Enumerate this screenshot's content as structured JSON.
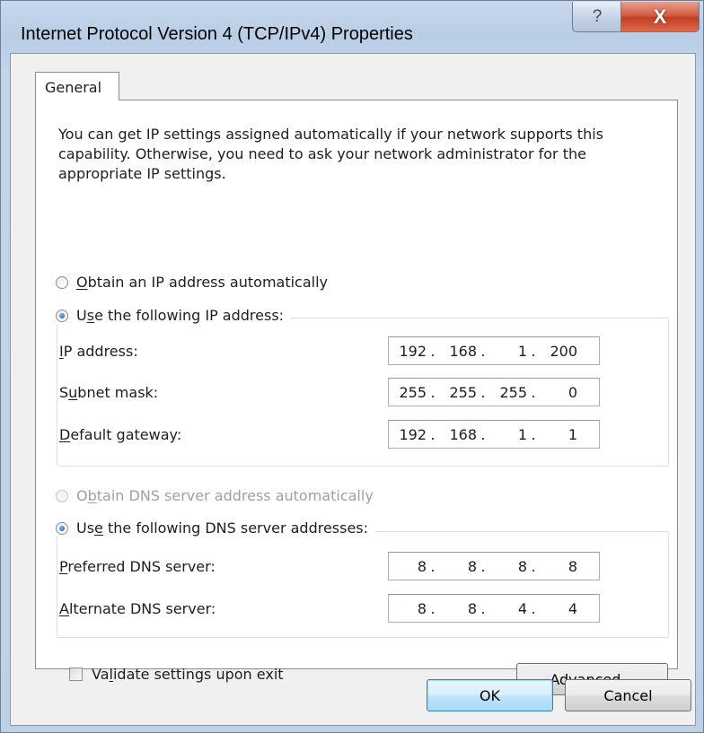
{
  "window": {
    "title": "Internet Protocol Version 4 (TCP/IPv4) Properties",
    "help_button": "?",
    "close_button": "X"
  },
  "tabs": [
    {
      "label": "General",
      "selected": true
    }
  ],
  "description": "You can get IP settings assigned automatically if your network supports this capability. Otherwise, you need to ask your network administrator for the appropriate IP settings.",
  "ip_section": {
    "auto": {
      "label_key": "O",
      "label_rest": "btain an IP address automatically",
      "selected": false
    },
    "manual": {
      "label_pre": "U",
      "label_key": "s",
      "label_rest": "e the following IP address:",
      "selected": true
    },
    "fields": [
      {
        "label_pre": "",
        "label_key": "I",
        "label_rest": "P address:",
        "octets": [
          "192",
          "168",
          "1",
          "200"
        ]
      },
      {
        "label_pre": "S",
        "label_key": "u",
        "label_rest": "bnet mask:",
        "octets": [
          "255",
          "255",
          "255",
          "0"
        ]
      },
      {
        "label_pre": "",
        "label_key": "D",
        "label_rest": "efault gateway:",
        "octets": [
          "192",
          "168",
          "1",
          "1"
        ]
      }
    ]
  },
  "dns_section": {
    "auto": {
      "label_pre": "O",
      "label_key": "b",
      "label_rest": "tain DNS server address automatically",
      "selected": false,
      "enabled": false
    },
    "manual": {
      "label_pre": "Us",
      "label_key": "e",
      "label_rest": " the following DNS server addresses:",
      "selected": true
    },
    "fields": [
      {
        "label_pre": "",
        "label_key": "P",
        "label_rest": "referred DNS server:",
        "octets": [
          "8",
          "8",
          "8",
          "8"
        ]
      },
      {
        "label_pre": "",
        "label_key": "A",
        "label_rest": "lternate DNS server:",
        "octets": [
          "8",
          "8",
          "4",
          "4"
        ]
      }
    ]
  },
  "validate": {
    "label_pre": "Va",
    "label_key": "l",
    "label_rest": "idate settings upon exit",
    "checked": false
  },
  "buttons": {
    "advanced": {
      "pre": "Ad",
      "key": "v",
      "rest": "anced..."
    },
    "ok": "OK",
    "cancel": "Cancel"
  },
  "colors": {
    "title_bar": "#c2d4ea",
    "close_button": "#c9452a",
    "default_button_border": "#3c7fb1"
  }
}
